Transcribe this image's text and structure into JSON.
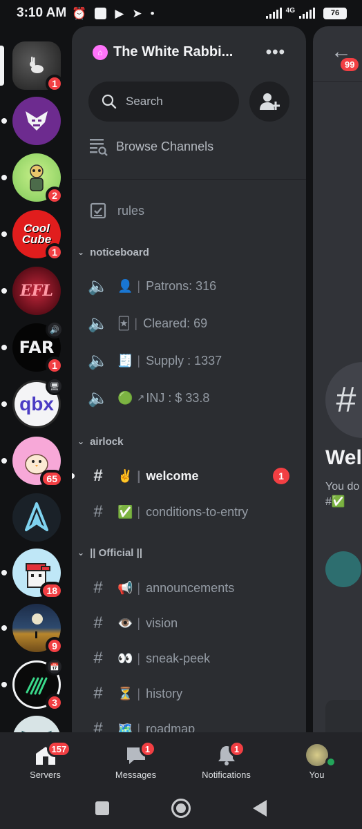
{
  "status_bar": {
    "time": "3:10 AM",
    "network": "4G",
    "battery": "76"
  },
  "server": {
    "name": "The White Rabbi...",
    "search_placeholder": "Search",
    "browse_label": "Browse Channels"
  },
  "servers": [
    {
      "badge": "1"
    },
    {
      "badge": ""
    },
    {
      "badge": "2"
    },
    {
      "badge": "1"
    },
    {
      "badge": ""
    },
    {
      "badge": "1"
    },
    {
      "badge": ""
    },
    {
      "badge": "65"
    },
    {
      "badge": ""
    },
    {
      "badge": "18"
    },
    {
      "badge": "9"
    },
    {
      "badge": "3"
    },
    {
      "badge": ""
    }
  ],
  "server_labels": {
    "far": "FAR",
    "qbx": "qbx",
    "efl": "EFL",
    "cool": "Cool Cube"
  },
  "channels": {
    "rules": "rules",
    "noticeboard": {
      "category": "noticeboard",
      "items": [
        {
          "emoji": "👤",
          "label": "Patrons: 316"
        },
        {
          "emoji": "🃏",
          "label": "Cleared: 69"
        },
        {
          "emoji": "🧾",
          "label": "Supply : 1337"
        },
        {
          "emoji": "🟢",
          "arrow": "↗",
          "label": "INJ : $ 33.8"
        }
      ]
    },
    "airlock": {
      "category": "airlock",
      "items": [
        {
          "emoji": "✌️",
          "label": "welcome",
          "badge": "1"
        },
        {
          "emoji": "✅",
          "label": "conditions-to-entry"
        }
      ]
    },
    "official": {
      "category": "|| Official ||",
      "items": [
        {
          "emoji": "📢",
          "label": "announcements"
        },
        {
          "emoji": "👁️",
          "label": "vision"
        },
        {
          "emoji": "👀",
          "label": "sneak-peek"
        },
        {
          "emoji": "⏳",
          "label": "history"
        },
        {
          "emoji": "🗺️",
          "label": "roadmap"
        }
      ]
    }
  },
  "peek": {
    "badge": "99",
    "hash": "#",
    "welcome": "Welc",
    "sub_line1": "You do",
    "sub_line2": "#✅"
  },
  "bottom_nav": [
    {
      "label": "Servers",
      "badge": "157"
    },
    {
      "label": "Messages",
      "badge": "1"
    },
    {
      "label": "Notifications",
      "badge": "1"
    },
    {
      "label": "You",
      "badge": ""
    }
  ],
  "colors": {
    "accent_red": "#f23f43",
    "panel": "#2b2d31",
    "rail": "#111214",
    "boost": "#ff73fa"
  }
}
